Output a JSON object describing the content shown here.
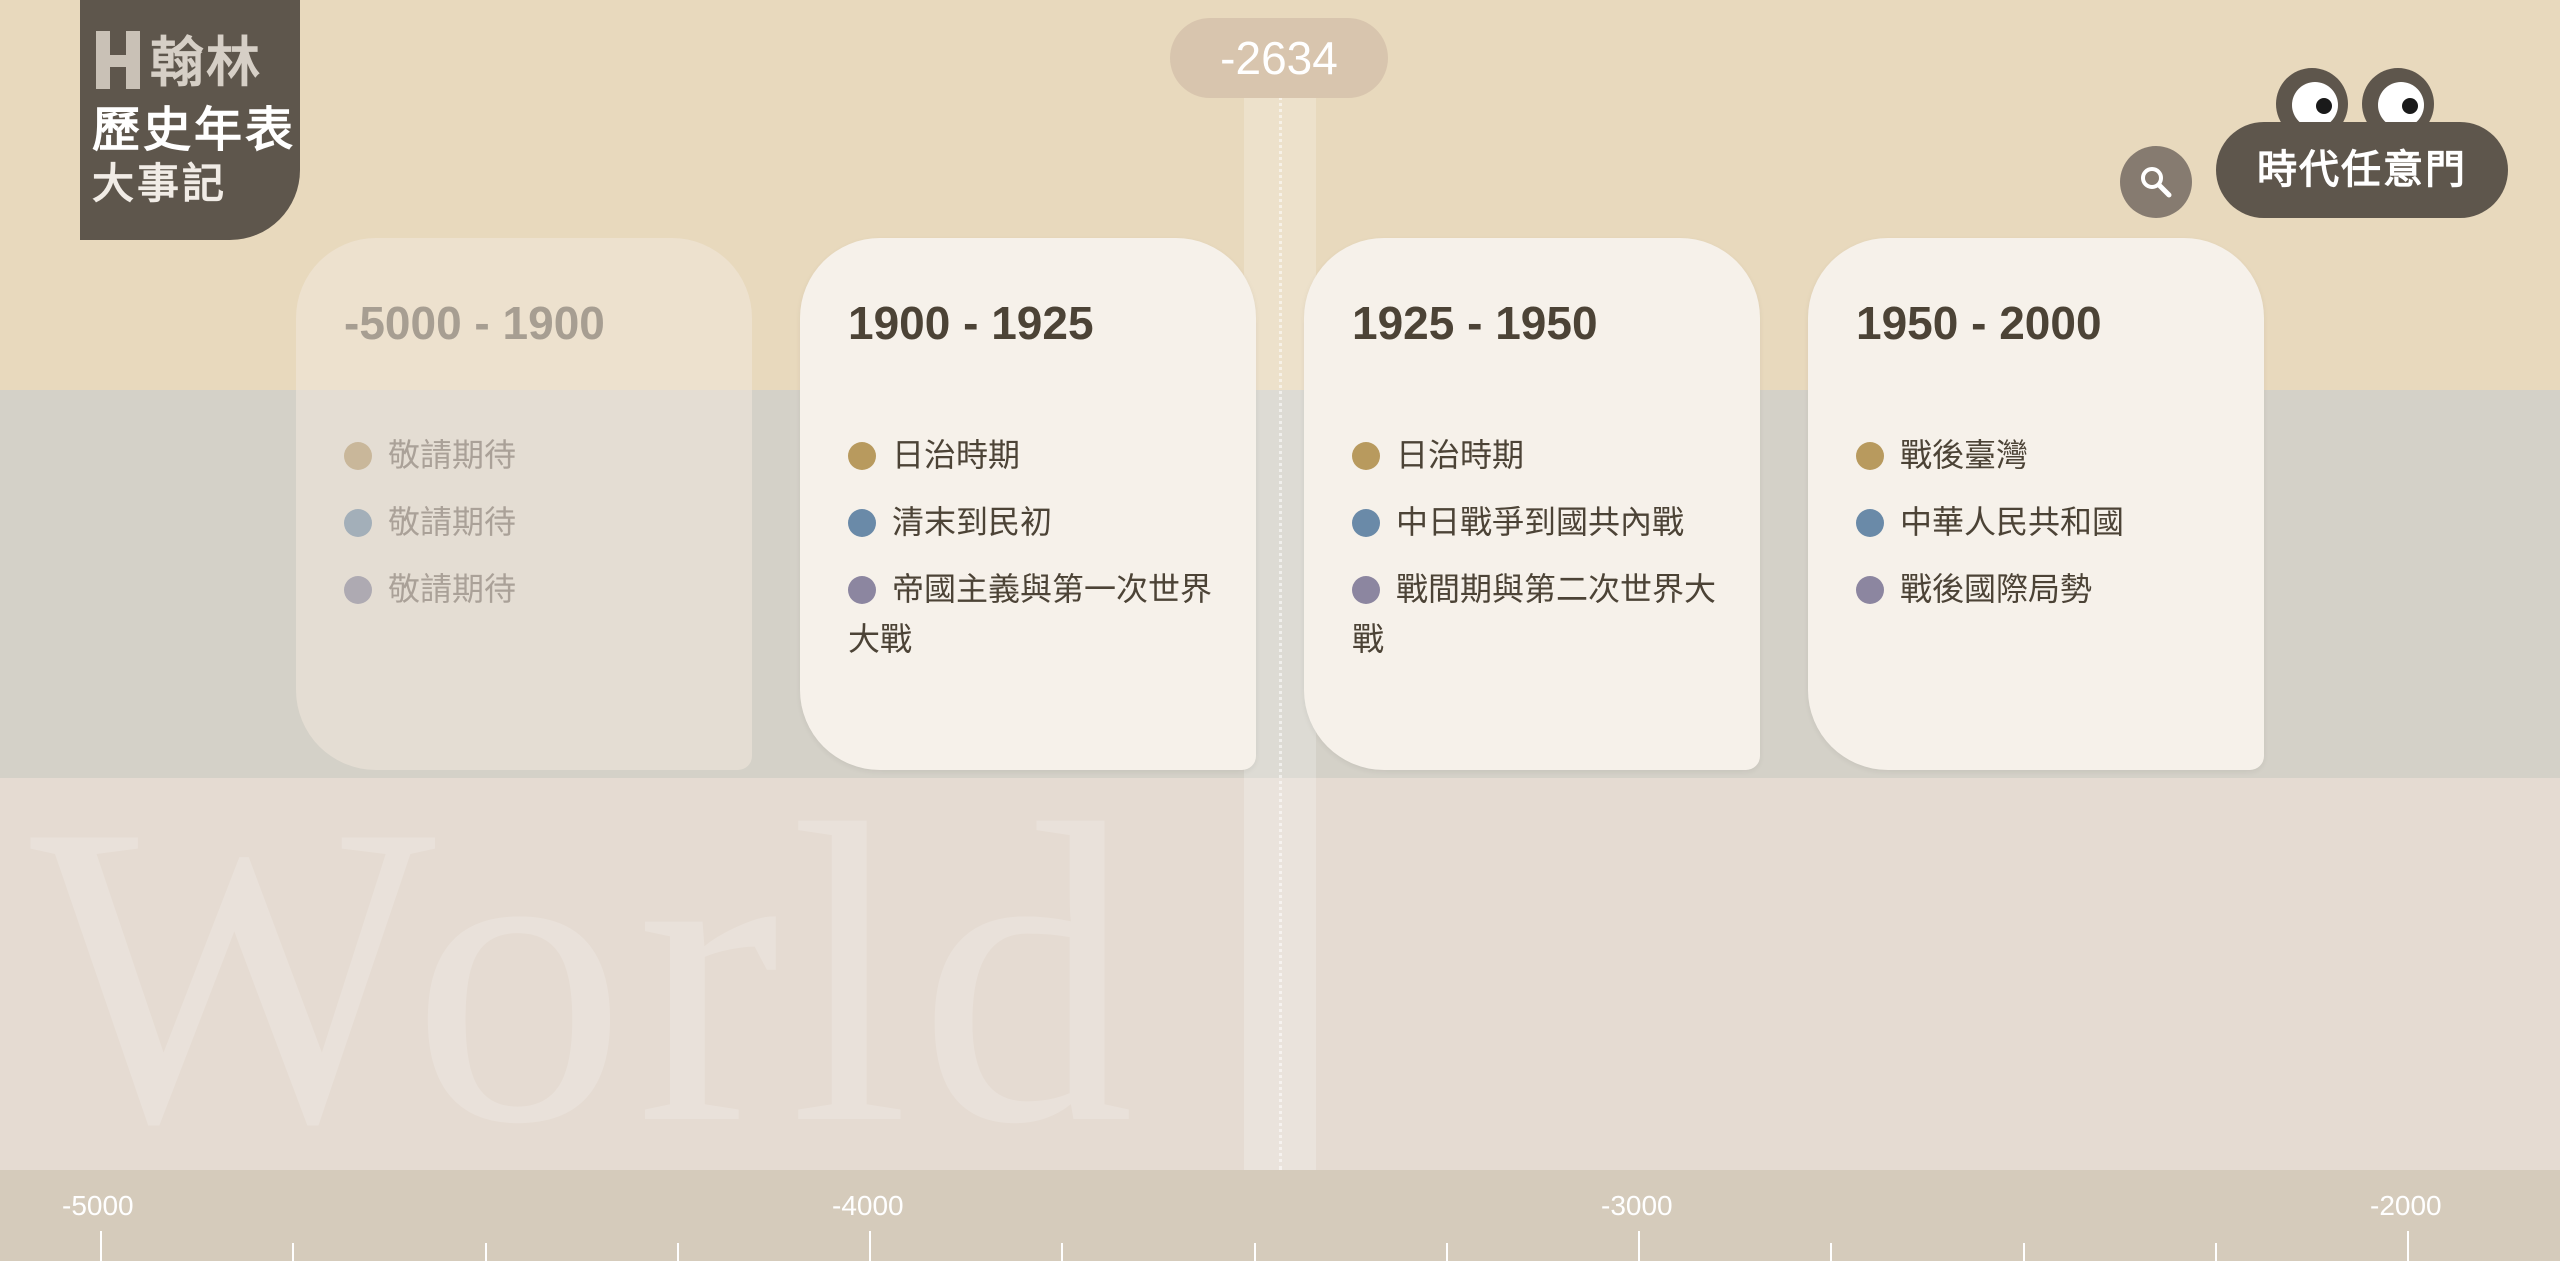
{
  "logo": {
    "brand": "翰林",
    "line1": "歷史年表",
    "line2": "大事記"
  },
  "watermark": "World",
  "current_year": "-2634",
  "door_button": {
    "label": "時代任意門"
  },
  "colors": {
    "gold": "#b89a5e",
    "blue": "#6a8aa8",
    "purple": "#8c86a0",
    "dark": "#5e564c"
  },
  "cards": [
    {
      "title": "-5000 - 1900",
      "topics": [
        {
          "label": "敬請期待",
          "color": "#c9b79a"
        },
        {
          "label": "敬請期待",
          "color": "#a3afb9"
        },
        {
          "label": "敬請期待",
          "color": "#aeaab2"
        }
      ]
    },
    {
      "title": "1900 - 1925",
      "topics": [
        {
          "label": "日治時期",
          "color": "#b89a5e"
        },
        {
          "label": "清末到民初",
          "color": "#6a8aa8"
        },
        {
          "label": "帝國主義與第一次世界大戰",
          "color": "#8c86a0"
        }
      ]
    },
    {
      "title": "1925 - 1950",
      "topics": [
        {
          "label": "日治時期",
          "color": "#b89a5e"
        },
        {
          "label": "中日戰爭到國共內戰",
          "color": "#6a8aa8"
        },
        {
          "label": "戰間期與第二次世界大戰",
          "color": "#8c86a0"
        }
      ]
    },
    {
      "title": "1950 - 2000",
      "topics": [
        {
          "label": "戰後臺灣",
          "color": "#b89a5e"
        },
        {
          "label": "中華人民共和國",
          "color": "#6a8aa8"
        },
        {
          "label": "戰後國際局勢",
          "color": "#8c86a0"
        }
      ]
    }
  ],
  "ruler": {
    "labels": [
      "-5000",
      "-4000",
      "-3000",
      "-2000"
    ]
  }
}
